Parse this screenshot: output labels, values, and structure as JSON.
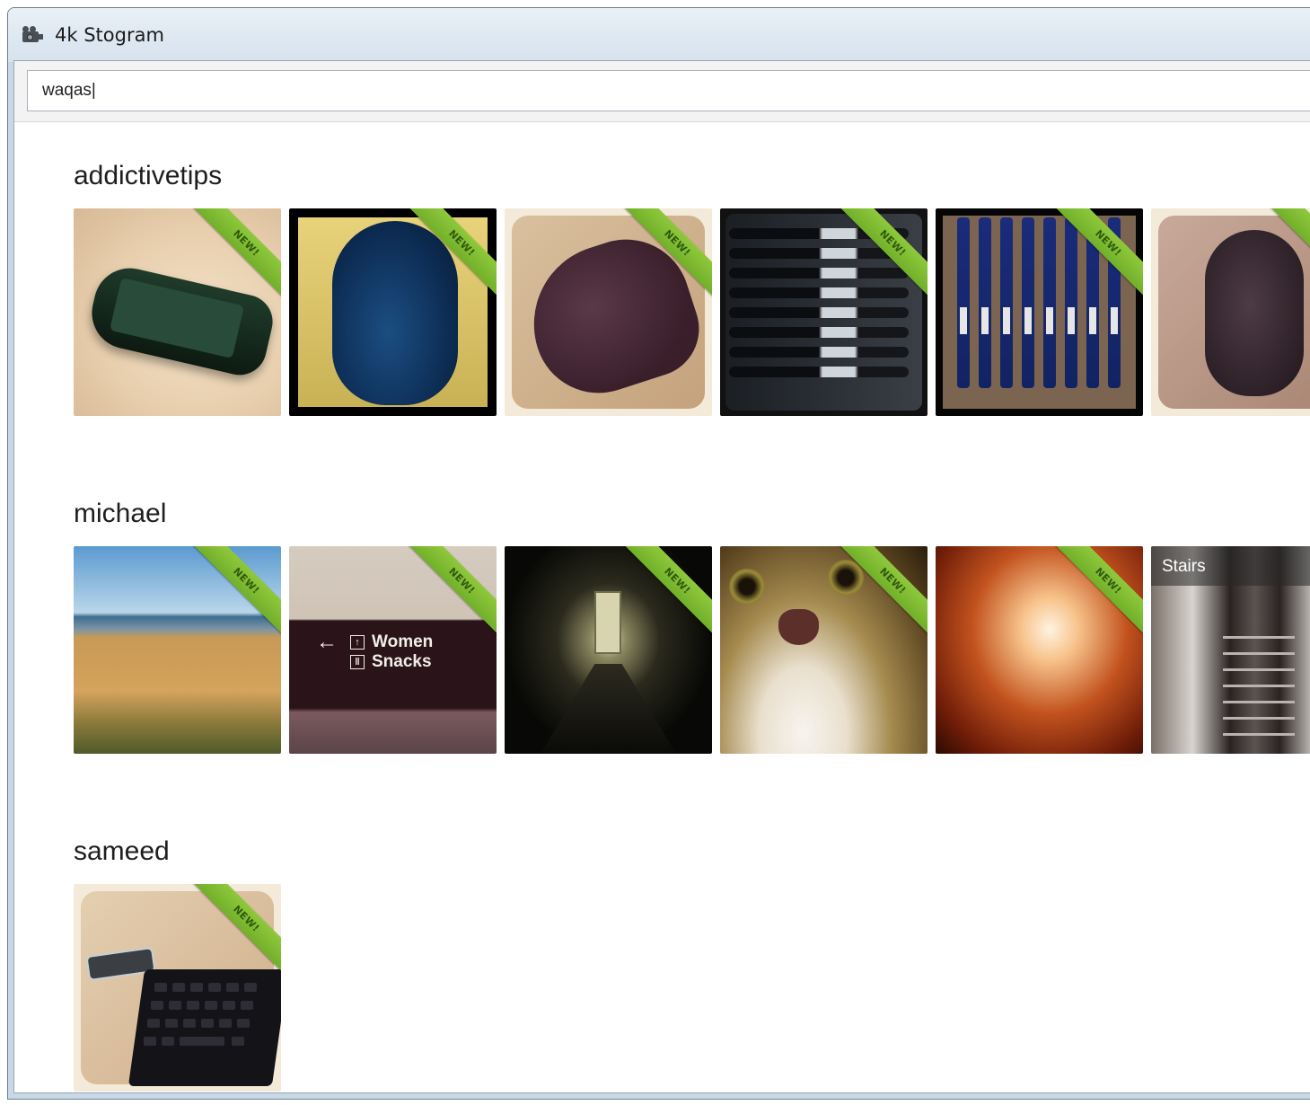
{
  "window": {
    "title": "4k Stogram",
    "icon": "film-camera-icon"
  },
  "search": {
    "value": "waqas|",
    "placeholder": ""
  },
  "users": [
    {
      "name": "addictivetips",
      "photos": [
        {
          "subject": "phone",
          "badge": "NEW!"
        },
        {
          "subject": "mouse-blue",
          "badge": "NEW!"
        },
        {
          "subject": "mouse-purple",
          "badge": "NEW!"
        },
        {
          "subject": "pens",
          "badge": "NEW!"
        },
        {
          "subject": "pencils",
          "badge": "NEW!"
        },
        {
          "subject": "mouse-grey",
          "badge": "NEW!"
        }
      ]
    },
    {
      "name": "michael",
      "photos": [
        {
          "subject": "beach",
          "badge": "NEW!"
        },
        {
          "subject": "sign",
          "badge": "NEW!",
          "sign_lines": [
            "Women",
            "Snacks"
          ]
        },
        {
          "subject": "hallway",
          "badge": "NEW!"
        },
        {
          "subject": "cat",
          "badge": "NEW!"
        },
        {
          "subject": "factory",
          "badge": "NEW!"
        },
        {
          "subject": "stairs",
          "badge": "",
          "caption": "Stairs"
        }
      ]
    },
    {
      "name": "sameed",
      "photos": [
        {
          "subject": "keyboard",
          "badge": "NEW!"
        }
      ]
    }
  ],
  "colors": {
    "ribbon": "#7fbd33",
    "titlebar": "#dbe6f1"
  }
}
